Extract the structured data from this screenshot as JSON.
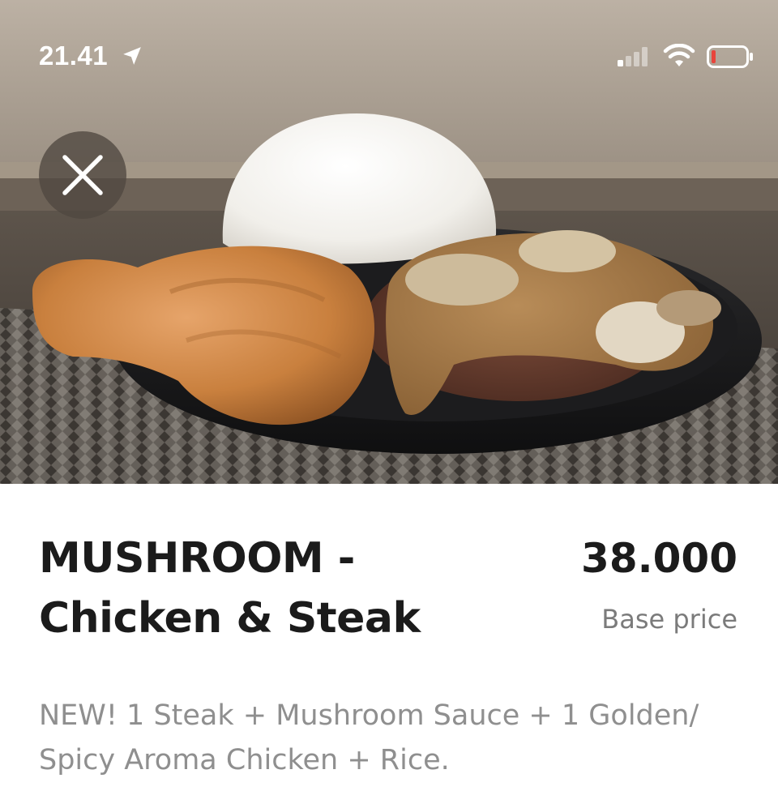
{
  "status_bar": {
    "time": "21.41",
    "location_icon": "location-arrow-icon",
    "signal_icon": "cellular-signal-icon",
    "wifi_icon": "wifi-icon",
    "battery_icon": "battery-low-icon",
    "battery_level_color": "#e8453c"
  },
  "hero": {
    "image_subject": "fried chicken, steak with mushroom sauce and rice on a black plate",
    "close_icon": "close-icon"
  },
  "product": {
    "name_line1": "MUSHROOM -",
    "name_line2": "Chicken & Steak",
    "price": "38.000",
    "price_caption": "Base price",
    "description": "NEW! 1 Steak + Mushroom Sauce + 1 Golden/ Spicy Aroma Chicken + Rice."
  },
  "colors": {
    "title_text": "#1b1b1b",
    "secondary_text": "#7b7b7b",
    "description_text": "#8f8f8f",
    "background": "#ffffff"
  }
}
